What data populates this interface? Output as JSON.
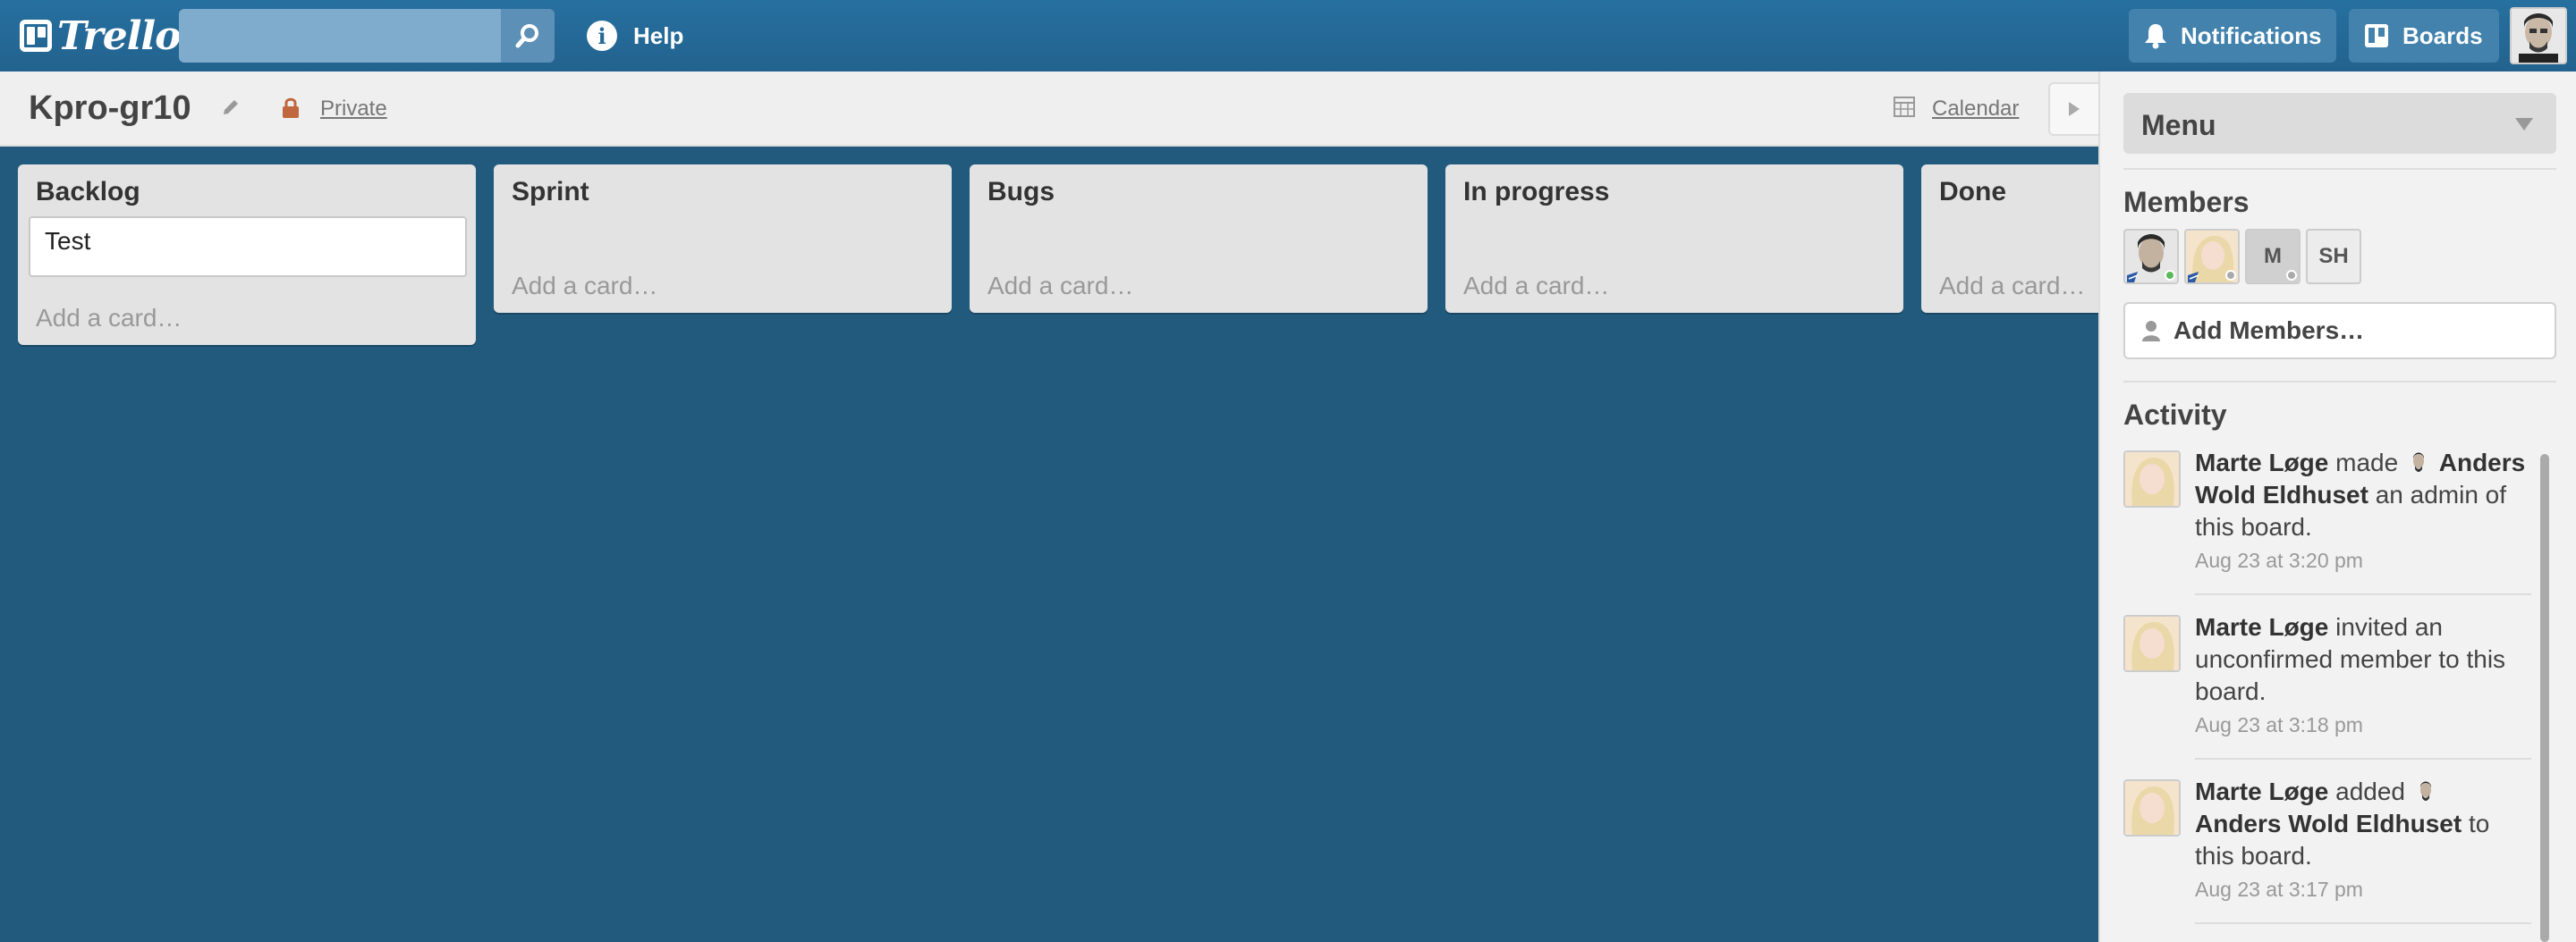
{
  "header": {
    "logo_text": "Trello",
    "search": {
      "value": "",
      "placeholder": ""
    },
    "help_label": "Help",
    "notifications_label": "Notifications",
    "boards_label": "Boards"
  },
  "board": {
    "title": "Kpro-gr10",
    "privacy": "Private",
    "calendar_label": "Calendar"
  },
  "lists": [
    {
      "title": "Backlog",
      "cards": [],
      "composer_value": "Test",
      "add_card": "Add a card…"
    },
    {
      "title": "Sprint",
      "cards": [],
      "add_card": "Add a card…"
    },
    {
      "title": "Bugs",
      "cards": [],
      "add_card": "Add a card…"
    },
    {
      "title": "In progress",
      "cards": [],
      "add_card": "Add a card…"
    },
    {
      "title": "Done",
      "cards": [],
      "add_card": "Add a card…"
    }
  ],
  "sidebar": {
    "menu_label": "Menu",
    "members_title": "Members",
    "members": [
      {
        "kind": "photo",
        "status": "online"
      },
      {
        "kind": "photo",
        "status": "idle"
      },
      {
        "kind": "initials",
        "initials": "M",
        "status": "idle"
      },
      {
        "kind": "initials",
        "initials": "SH"
      }
    ],
    "add_members_label": "Add Members…",
    "activity_title": "Activity",
    "activity": [
      {
        "actor": "Marte Løge",
        "verb": "made",
        "target": "Anders Wold Eldhuset",
        "rest": "an admin of this board.",
        "date": "Aug 23 at 3:20 pm"
      },
      {
        "actor": "Marte Løge",
        "rest": "invited an unconfirmed member to this board.",
        "date": "Aug 23 at 3:18 pm"
      },
      {
        "actor": "Marte Løge",
        "verb": "added",
        "target": "Anders Wold Eldhuset",
        "rest": "to this board.",
        "date": "Aug 23 at 3:17 pm"
      }
    ]
  },
  "colors": {
    "header": "#2670a0",
    "board_bg": "#215a7d",
    "list_bg": "#e3e3e3",
    "online": "#5ab95a",
    "idle": "#aaaaaa"
  }
}
